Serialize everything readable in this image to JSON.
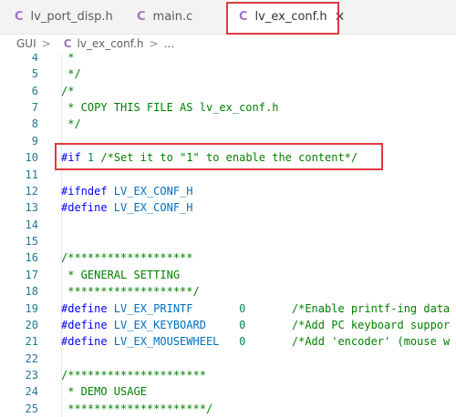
{
  "tabs": [
    {
      "label": "lv_port_disp.h",
      "icon": "c-file-icon",
      "active": false
    },
    {
      "label": "main.c",
      "icon": "c-file-icon",
      "active": false
    },
    {
      "label": "lv_ex_conf.h",
      "icon": "c-file-icon",
      "active": true
    }
  ],
  "icon_glyph": "C",
  "close_glyph": "✕",
  "breadcrumb": {
    "folder": "GUI",
    "file": "lv_ex_conf.h",
    "more": "...",
    "separator": ">"
  },
  "editor": {
    "lines": [
      {
        "num": "4",
        "text": " *"
      },
      {
        "num": "5",
        "text": " */"
      },
      {
        "num": "6",
        "text": "/*"
      },
      {
        "num": "7",
        "text": " * COPY THIS FILE AS lv_ex_conf.h"
      },
      {
        "num": "8",
        "text": " */"
      },
      {
        "num": "9",
        "text": ""
      },
      {
        "num": "10",
        "pre": "#if",
        "val": " 1 ",
        "comment": "/*Set it to \"1\" to enable the content*/"
      },
      {
        "num": "11",
        "text": ""
      },
      {
        "num": "12",
        "pre": "#ifndef",
        "mac": " LV_EX_CONF_H"
      },
      {
        "num": "13",
        "pre": "#define",
        "mac": " LV_EX_CONF_H"
      },
      {
        "num": "14",
        "text": ""
      },
      {
        "num": "15",
        "text": ""
      },
      {
        "num": "16",
        "text": "/*******************"
      },
      {
        "num": "17",
        "text": " * GENERAL SETTING"
      },
      {
        "num": "18",
        "text": " *******************/"
      },
      {
        "num": "19",
        "pre": "#define",
        "mac": " LV_EX_PRINTF       ",
        "val": "0",
        "comment": "       /*Enable printf-ing data"
      },
      {
        "num": "20",
        "pre": "#define",
        "mac": " LV_EX_KEYBOARD     ",
        "val": "0",
        "comment": "       /*Add PC keyboard suppor"
      },
      {
        "num": "21",
        "pre": "#define",
        "mac": " LV_EX_MOUSEWHEEL   ",
        "val": "0",
        "comment": "       /*Add 'encoder' (mouse w"
      },
      {
        "num": "22",
        "text": ""
      },
      {
        "num": "23",
        "text": "/*********************"
      },
      {
        "num": "24",
        "text": " * DEMO USAGE"
      },
      {
        "num": "25",
        "text": " *********************/"
      }
    ]
  }
}
